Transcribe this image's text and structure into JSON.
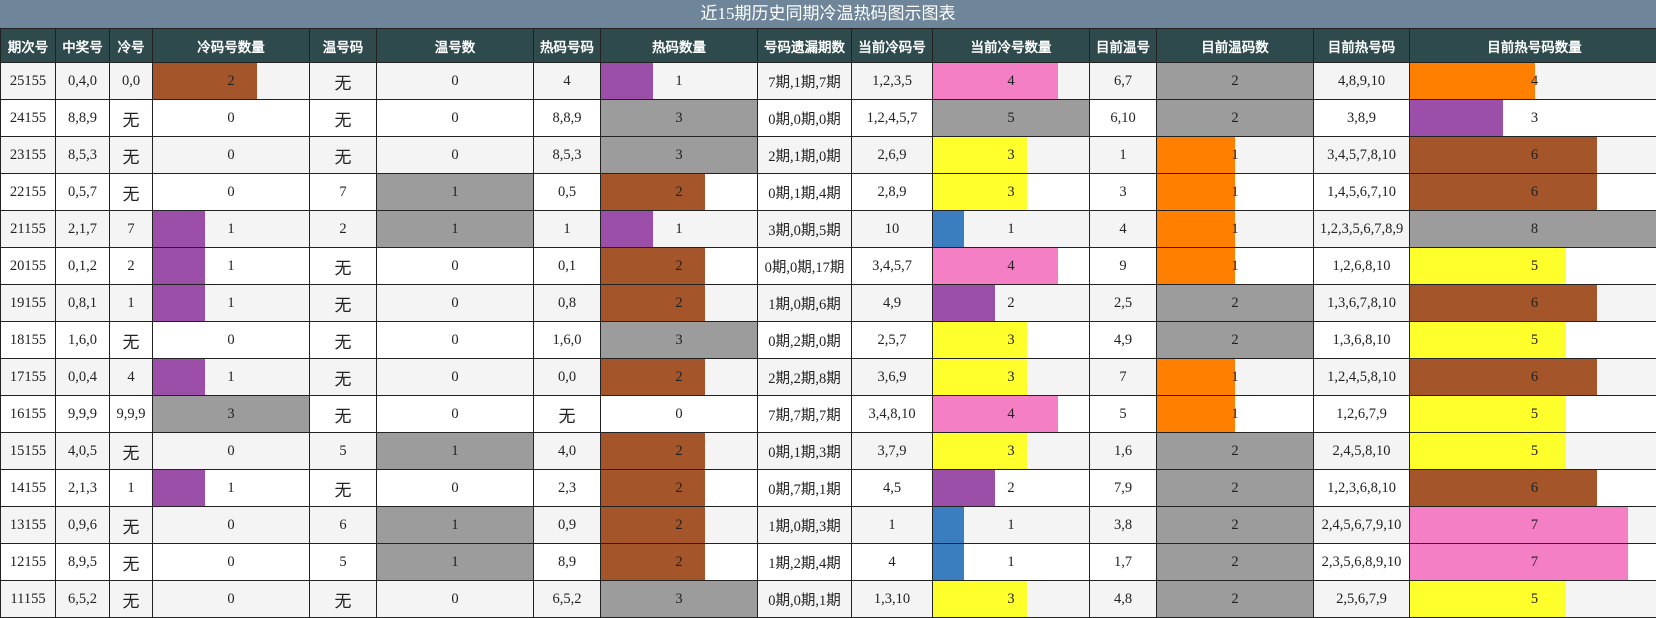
{
  "title": "近15期历史同期冷温热码图示图表",
  "columns": [
    "期次号",
    "中奖号",
    "冷号",
    "冷码号数量",
    "温号码",
    "温号数",
    "热码号码",
    "热码数量",
    "号码遗漏期数",
    "当前冷码号",
    "当前冷号数量",
    "目前温号",
    "目前温码数",
    "目前热号码",
    "目前热号码数量"
  ],
  "bar_max": {
    "cold_count": 3,
    "warm_count": 1,
    "hot_count": 3,
    "cur_cold_count": 5,
    "cur_warm_count": 2,
    "cur_hot_count": 8
  },
  "colors": {
    "1": "#9b4fa8",
    "2": "#a4562a",
    "3": "#9c9c9c",
    "4": "#f47fc4",
    "5": "#9c9c9c",
    "6": "#a4562a",
    "7": "#f47fc4",
    "8": "#9c9c9c",
    "purple": "#9b4fa8",
    "brown": "#a4562a",
    "gray": "#9c9c9c",
    "pink": "#f47fc4",
    "yellow": "#ffff2c",
    "orange": "#ff8000",
    "blue": "#3a7ebf"
  },
  "rows": [
    {
      "issue": "25155",
      "win": "0,4,0",
      "cold": "0,0",
      "cold_count": 2,
      "cold_color": "brown",
      "warm": "无",
      "warm_count": 0,
      "warm_color": "gray",
      "hot": "4",
      "hot_count": 1,
      "hot_color": "purple",
      "miss": "7期,1期,7期",
      "cur_cold": "1,2,3,5",
      "cur_cold_count": 4,
      "cur_cold_color": "pink",
      "cur_warm": "6,7",
      "cur_warm_count": 2,
      "cur_warm_color": "gray",
      "cur_hot": "4,8,9,10",
      "cur_hot_count": 4,
      "cur_hot_color": "orange"
    },
    {
      "issue": "24155",
      "win": "8,8,9",
      "cold": "无",
      "cold_count": 0,
      "cold_color": "gray",
      "warm": "无",
      "warm_count": 0,
      "warm_color": "gray",
      "hot": "8,8,9",
      "hot_count": 3,
      "hot_color": "gray",
      "miss": "0期,0期,0期",
      "cur_cold": "1,2,4,5,7",
      "cur_cold_count": 5,
      "cur_cold_color": "gray",
      "cur_warm": "6,10",
      "cur_warm_count": 2,
      "cur_warm_color": "gray",
      "cur_hot": "3,8,9",
      "cur_hot_count": 3,
      "cur_hot_color": "purple"
    },
    {
      "issue": "23155",
      "win": "8,5,3",
      "cold": "无",
      "cold_count": 0,
      "cold_color": "gray",
      "warm": "无",
      "warm_count": 0,
      "warm_color": "gray",
      "hot": "8,5,3",
      "hot_count": 3,
      "hot_color": "gray",
      "miss": "2期,1期,0期",
      "cur_cold": "2,6,9",
      "cur_cold_count": 3,
      "cur_cold_color": "yellow",
      "cur_warm": "1",
      "cur_warm_count": 1,
      "cur_warm_color": "orange",
      "cur_hot": "3,4,5,7,8,10",
      "cur_hot_count": 6,
      "cur_hot_color": "brown"
    },
    {
      "issue": "22155",
      "win": "0,5,7",
      "cold": "无",
      "cold_count": 0,
      "cold_color": "gray",
      "warm": "7",
      "warm_count": 1,
      "warm_color": "gray",
      "hot": "0,5",
      "hot_count": 2,
      "hot_color": "brown",
      "miss": "0期,1期,4期",
      "cur_cold": "2,8,9",
      "cur_cold_count": 3,
      "cur_cold_color": "yellow",
      "cur_warm": "3",
      "cur_warm_count": 1,
      "cur_warm_color": "orange",
      "cur_hot": "1,4,5,6,7,10",
      "cur_hot_count": 6,
      "cur_hot_color": "brown"
    },
    {
      "issue": "21155",
      "win": "2,1,7",
      "cold": "7",
      "cold_count": 1,
      "cold_color": "purple",
      "warm": "2",
      "warm_count": 1,
      "warm_color": "gray",
      "hot": "1",
      "hot_count": 1,
      "hot_color": "purple",
      "miss": "3期,0期,5期",
      "cur_cold": "10",
      "cur_cold_count": 1,
      "cur_cold_color": "blue",
      "cur_warm": "4",
      "cur_warm_count": 1,
      "cur_warm_color": "orange",
      "cur_hot": "1,2,3,5,6,7,8,9",
      "cur_hot_count": 8,
      "cur_hot_color": "gray"
    },
    {
      "issue": "20155",
      "win": "0,1,2",
      "cold": "2",
      "cold_count": 1,
      "cold_color": "purple",
      "warm": "无",
      "warm_count": 0,
      "warm_color": "gray",
      "hot": "0,1",
      "hot_count": 2,
      "hot_color": "brown",
      "miss": "0期,0期,17期",
      "cur_cold": "3,4,5,7",
      "cur_cold_count": 4,
      "cur_cold_color": "pink",
      "cur_warm": "9",
      "cur_warm_count": 1,
      "cur_warm_color": "orange",
      "cur_hot": "1,2,6,8,10",
      "cur_hot_count": 5,
      "cur_hot_color": "yellow"
    },
    {
      "issue": "19155",
      "win": "0,8,1",
      "cold": "1",
      "cold_count": 1,
      "cold_color": "purple",
      "warm": "无",
      "warm_count": 0,
      "warm_color": "gray",
      "hot": "0,8",
      "hot_count": 2,
      "hot_color": "brown",
      "miss": "1期,0期,6期",
      "cur_cold": "4,9",
      "cur_cold_count": 2,
      "cur_cold_color": "purple",
      "cur_warm": "2,5",
      "cur_warm_count": 2,
      "cur_warm_color": "gray",
      "cur_hot": "1,3,6,7,8,10",
      "cur_hot_count": 6,
      "cur_hot_color": "brown"
    },
    {
      "issue": "18155",
      "win": "1,6,0",
      "cold": "无",
      "cold_count": 0,
      "cold_color": "gray",
      "warm": "无",
      "warm_count": 0,
      "warm_color": "gray",
      "hot": "1,6,0",
      "hot_count": 3,
      "hot_color": "gray",
      "miss": "0期,2期,0期",
      "cur_cold": "2,5,7",
      "cur_cold_count": 3,
      "cur_cold_color": "yellow",
      "cur_warm": "4,9",
      "cur_warm_count": 2,
      "cur_warm_color": "gray",
      "cur_hot": "1,3,6,8,10",
      "cur_hot_count": 5,
      "cur_hot_color": "yellow"
    },
    {
      "issue": "17155",
      "win": "0,0,4",
      "cold": "4",
      "cold_count": 1,
      "cold_color": "purple",
      "warm": "无",
      "warm_count": 0,
      "warm_color": "gray",
      "hot": "0,0",
      "hot_count": 2,
      "hot_color": "brown",
      "miss": "2期,2期,8期",
      "cur_cold": "3,6,9",
      "cur_cold_count": 3,
      "cur_cold_color": "yellow",
      "cur_warm": "7",
      "cur_warm_count": 1,
      "cur_warm_color": "orange",
      "cur_hot": "1,2,4,5,8,10",
      "cur_hot_count": 6,
      "cur_hot_color": "brown"
    },
    {
      "issue": "16155",
      "win": "9,9,9",
      "cold": "9,9,9",
      "cold_count": 3,
      "cold_color": "gray",
      "warm": "无",
      "warm_count": 0,
      "warm_color": "gray",
      "hot": "无",
      "hot_count": 0,
      "hot_color": "gray",
      "miss": "7期,7期,7期",
      "cur_cold": "3,4,8,10",
      "cur_cold_count": 4,
      "cur_cold_color": "pink",
      "cur_warm": "5",
      "cur_warm_count": 1,
      "cur_warm_color": "orange",
      "cur_hot": "1,2,6,7,9",
      "cur_hot_count": 5,
      "cur_hot_color": "yellow"
    },
    {
      "issue": "15155",
      "win": "4,0,5",
      "cold": "无",
      "cold_count": 0,
      "cold_color": "gray",
      "warm": "5",
      "warm_count": 1,
      "warm_color": "gray",
      "hot": "4,0",
      "hot_count": 2,
      "hot_color": "brown",
      "miss": "0期,1期,3期",
      "cur_cold": "3,7,9",
      "cur_cold_count": 3,
      "cur_cold_color": "yellow",
      "cur_warm": "1,6",
      "cur_warm_count": 2,
      "cur_warm_color": "gray",
      "cur_hot": "2,4,5,8,10",
      "cur_hot_count": 5,
      "cur_hot_color": "yellow"
    },
    {
      "issue": "14155",
      "win": "2,1,3",
      "cold": "1",
      "cold_count": 1,
      "cold_color": "purple",
      "warm": "无",
      "warm_count": 0,
      "warm_color": "gray",
      "hot": "2,3",
      "hot_count": 2,
      "hot_color": "brown",
      "miss": "0期,7期,1期",
      "cur_cold": "4,5",
      "cur_cold_count": 2,
      "cur_cold_color": "purple",
      "cur_warm": "7,9",
      "cur_warm_count": 2,
      "cur_warm_color": "gray",
      "cur_hot": "1,2,3,6,8,10",
      "cur_hot_count": 6,
      "cur_hot_color": "brown"
    },
    {
      "issue": "13155",
      "win": "0,9,6",
      "cold": "无",
      "cold_count": 0,
      "cold_color": "gray",
      "warm": "6",
      "warm_count": 1,
      "warm_color": "gray",
      "hot": "0,9",
      "hot_count": 2,
      "hot_color": "brown",
      "miss": "1期,0期,3期",
      "cur_cold": "1",
      "cur_cold_count": 1,
      "cur_cold_color": "blue",
      "cur_warm": "3,8",
      "cur_warm_count": 2,
      "cur_warm_color": "gray",
      "cur_hot": "2,4,5,6,7,9,10",
      "cur_hot_count": 7,
      "cur_hot_color": "pink"
    },
    {
      "issue": "12155",
      "win": "8,9,5",
      "cold": "无",
      "cold_count": 0,
      "cold_color": "gray",
      "warm": "5",
      "warm_count": 1,
      "warm_color": "gray",
      "hot": "8,9",
      "hot_count": 2,
      "hot_color": "brown",
      "miss": "1期,2期,4期",
      "cur_cold": "4",
      "cur_cold_count": 1,
      "cur_cold_color": "blue",
      "cur_warm": "1,7",
      "cur_warm_count": 2,
      "cur_warm_color": "gray",
      "cur_hot": "2,3,5,6,8,9,10",
      "cur_hot_count": 7,
      "cur_hot_color": "pink"
    },
    {
      "issue": "11155",
      "win": "6,5,2",
      "cold": "无",
      "cold_count": 0,
      "cold_color": "gray",
      "warm": "无",
      "warm_count": 0,
      "warm_color": "gray",
      "hot": "6,5,2",
      "hot_count": 3,
      "hot_color": "gray",
      "miss": "0期,0期,1期",
      "cur_cold": "1,3,10",
      "cur_cold_count": 3,
      "cur_cold_color": "yellow",
      "cur_warm": "4,8",
      "cur_warm_count": 2,
      "cur_warm_color": "gray",
      "cur_hot": "2,5,6,7,9",
      "cur_hot_count": 5,
      "cur_hot_color": "yellow"
    }
  ]
}
